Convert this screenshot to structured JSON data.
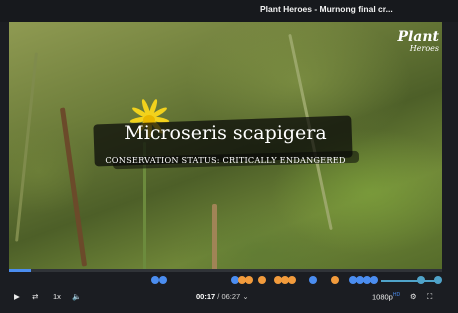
{
  "window": {
    "title": "Plant Heroes - Murnong final cr..."
  },
  "overlay": {
    "species_name": "Microseris scapigera",
    "status_text": "CONSERVATION STATUS: CRITICALLY ENDANGERED",
    "logo_line1": "Plant",
    "logo_line2": "Heroes"
  },
  "player": {
    "progress_fraction": 0.05,
    "current_time": "00:17",
    "separator": " / ",
    "duration": "06:27",
    "duration_suffix": " ⌄",
    "speed": "1x",
    "quality": "1080p",
    "quality_badge": "HD",
    "colors": {
      "accent": "#4b8df0",
      "orange": "#f29b3c",
      "teal": "#4fa3c9"
    }
  },
  "icons": {
    "play": "▶",
    "loop": "⇄",
    "volume": "🔈",
    "settings": "⚙",
    "fullscreen": "⛶"
  }
}
